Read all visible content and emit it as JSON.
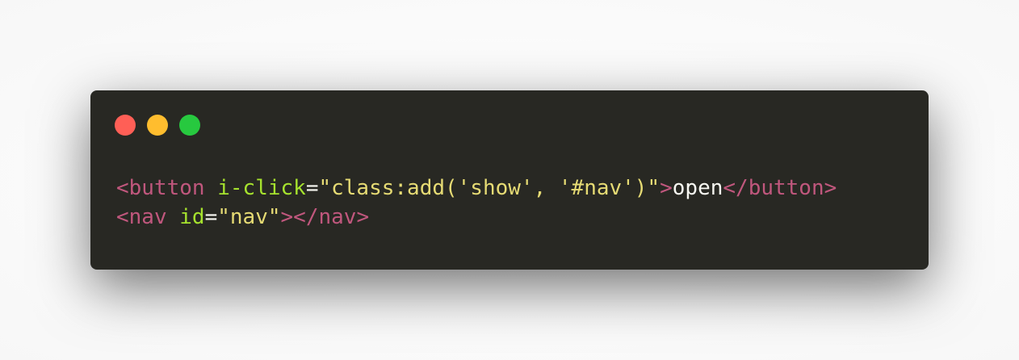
{
  "window": {
    "controls": {
      "close": {
        "icon": "red-dot-icon",
        "color": "#ff5f56"
      },
      "minimize": {
        "icon": "yellow-dot-icon",
        "color": "#ffbd2e"
      },
      "maximize": {
        "icon": "green-dot-icon",
        "color": "#27c93f"
      }
    },
    "background": "#282823"
  },
  "code": {
    "lines": [
      {
        "tokens": [
          {
            "type": "tag",
            "text": "<button"
          },
          {
            "type": "space",
            "text": " "
          },
          {
            "type": "attr",
            "text": "i-click"
          },
          {
            "type": "eq",
            "text": "="
          },
          {
            "type": "str",
            "text": "\"class:add('show', '#nav')\""
          },
          {
            "type": "tag",
            "text": ">"
          },
          {
            "type": "text",
            "text": "open"
          },
          {
            "type": "tag",
            "text": "</button>"
          }
        ]
      },
      {
        "tokens": [
          {
            "type": "tag",
            "text": "<nav"
          },
          {
            "type": "space",
            "text": " "
          },
          {
            "type": "attr",
            "text": "id"
          },
          {
            "type": "eq",
            "text": "="
          },
          {
            "type": "str",
            "text": "\"nav\""
          },
          {
            "type": "tag",
            "text": "></nav>"
          }
        ]
      }
    ],
    "colors": {
      "tag": "#c0577d",
      "attr": "#a6e22e",
      "str": "#e6db74",
      "text": "#f8f8f2"
    }
  }
}
